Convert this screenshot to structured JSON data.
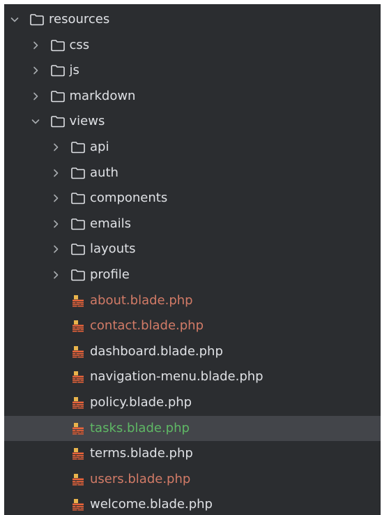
{
  "colors": {
    "panel_bg": "#2b2d30",
    "selected_bg": "#43454a",
    "text_default": "#dfe1e5",
    "text_modified": "#d27b67",
    "text_added": "#5fb865",
    "chevron": "#a8abb0",
    "folder_stroke": "#dfe1e5",
    "blade_orange": "#e8633a",
    "blade_yellow": "#e9b44c"
  },
  "tree": {
    "items": [
      {
        "label": "resources",
        "kind": "folder",
        "expanded": true,
        "depth": 0,
        "status": "default"
      },
      {
        "label": "css",
        "kind": "folder",
        "expanded": false,
        "depth": 1,
        "status": "default"
      },
      {
        "label": "js",
        "kind": "folder",
        "expanded": false,
        "depth": 1,
        "status": "default"
      },
      {
        "label": "markdown",
        "kind": "folder",
        "expanded": false,
        "depth": 1,
        "status": "default"
      },
      {
        "label": "views",
        "kind": "folder",
        "expanded": true,
        "depth": 1,
        "status": "default"
      },
      {
        "label": "api",
        "kind": "folder",
        "expanded": false,
        "depth": 2,
        "status": "default"
      },
      {
        "label": "auth",
        "kind": "folder",
        "expanded": false,
        "depth": 2,
        "status": "default"
      },
      {
        "label": "components",
        "kind": "folder",
        "expanded": false,
        "depth": 2,
        "status": "default"
      },
      {
        "label": "emails",
        "kind": "folder",
        "expanded": false,
        "depth": 2,
        "status": "default"
      },
      {
        "label": "layouts",
        "kind": "folder",
        "expanded": false,
        "depth": 2,
        "status": "default"
      },
      {
        "label": "profile",
        "kind": "folder",
        "expanded": false,
        "depth": 2,
        "status": "default"
      },
      {
        "label": "about.blade.php",
        "kind": "blade-file",
        "depth": 2,
        "status": "modified"
      },
      {
        "label": "contact.blade.php",
        "kind": "blade-file",
        "depth": 2,
        "status": "modified"
      },
      {
        "label": "dashboard.blade.php",
        "kind": "blade-file",
        "depth": 2,
        "status": "default"
      },
      {
        "label": "navigation-menu.blade.php",
        "kind": "blade-file",
        "depth": 2,
        "status": "default"
      },
      {
        "label": "policy.blade.php",
        "kind": "blade-file",
        "depth": 2,
        "status": "default"
      },
      {
        "label": "tasks.blade.php",
        "kind": "blade-file",
        "depth": 2,
        "status": "added",
        "selected": true
      },
      {
        "label": "terms.blade.php",
        "kind": "blade-file",
        "depth": 2,
        "status": "default"
      },
      {
        "label": "users.blade.php",
        "kind": "blade-file",
        "depth": 2,
        "status": "modified"
      },
      {
        "label": "welcome.blade.php",
        "kind": "blade-file",
        "depth": 2,
        "status": "default"
      }
    ]
  }
}
